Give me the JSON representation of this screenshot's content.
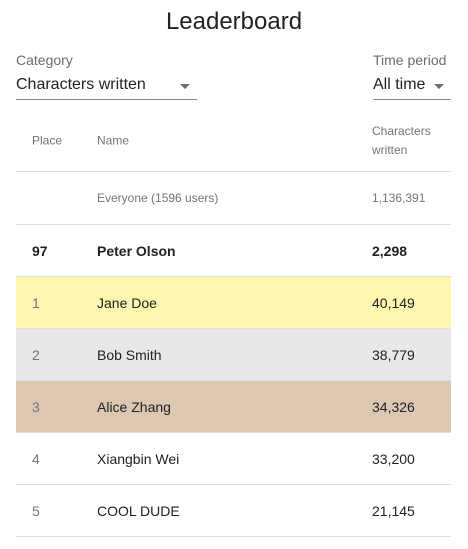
{
  "title": "Leaderboard",
  "category": {
    "label": "Category",
    "value": "Characters written"
  },
  "time_period": {
    "label": "Time period",
    "value": "All time"
  },
  "table": {
    "columns": {
      "place": "Place",
      "name": "Name",
      "chars": "Characters written"
    },
    "everyone": {
      "place": "",
      "name": "Everyone (1596 users)",
      "chars": "1,136,391"
    },
    "current_user": {
      "place": "97",
      "name": "Peter Olson",
      "chars": "2,298"
    },
    "rows": [
      {
        "place": "1",
        "name": "Jane Doe",
        "chars": "40,149",
        "highlight": "#fff6b0"
      },
      {
        "place": "2",
        "name": "Bob Smith",
        "chars": "38,779",
        "highlight": "#e8e8e8"
      },
      {
        "place": "3",
        "name": "Alice Zhang",
        "chars": "34,326",
        "highlight": "#dcc7b3"
      },
      {
        "place": "4",
        "name": "Xiangbin Wei",
        "chars": "33,200"
      },
      {
        "place": "5",
        "name": "COOL DUDE",
        "chars": "21,145"
      }
    ]
  },
  "icons": {
    "dropdown": "chevron-down-icon"
  }
}
